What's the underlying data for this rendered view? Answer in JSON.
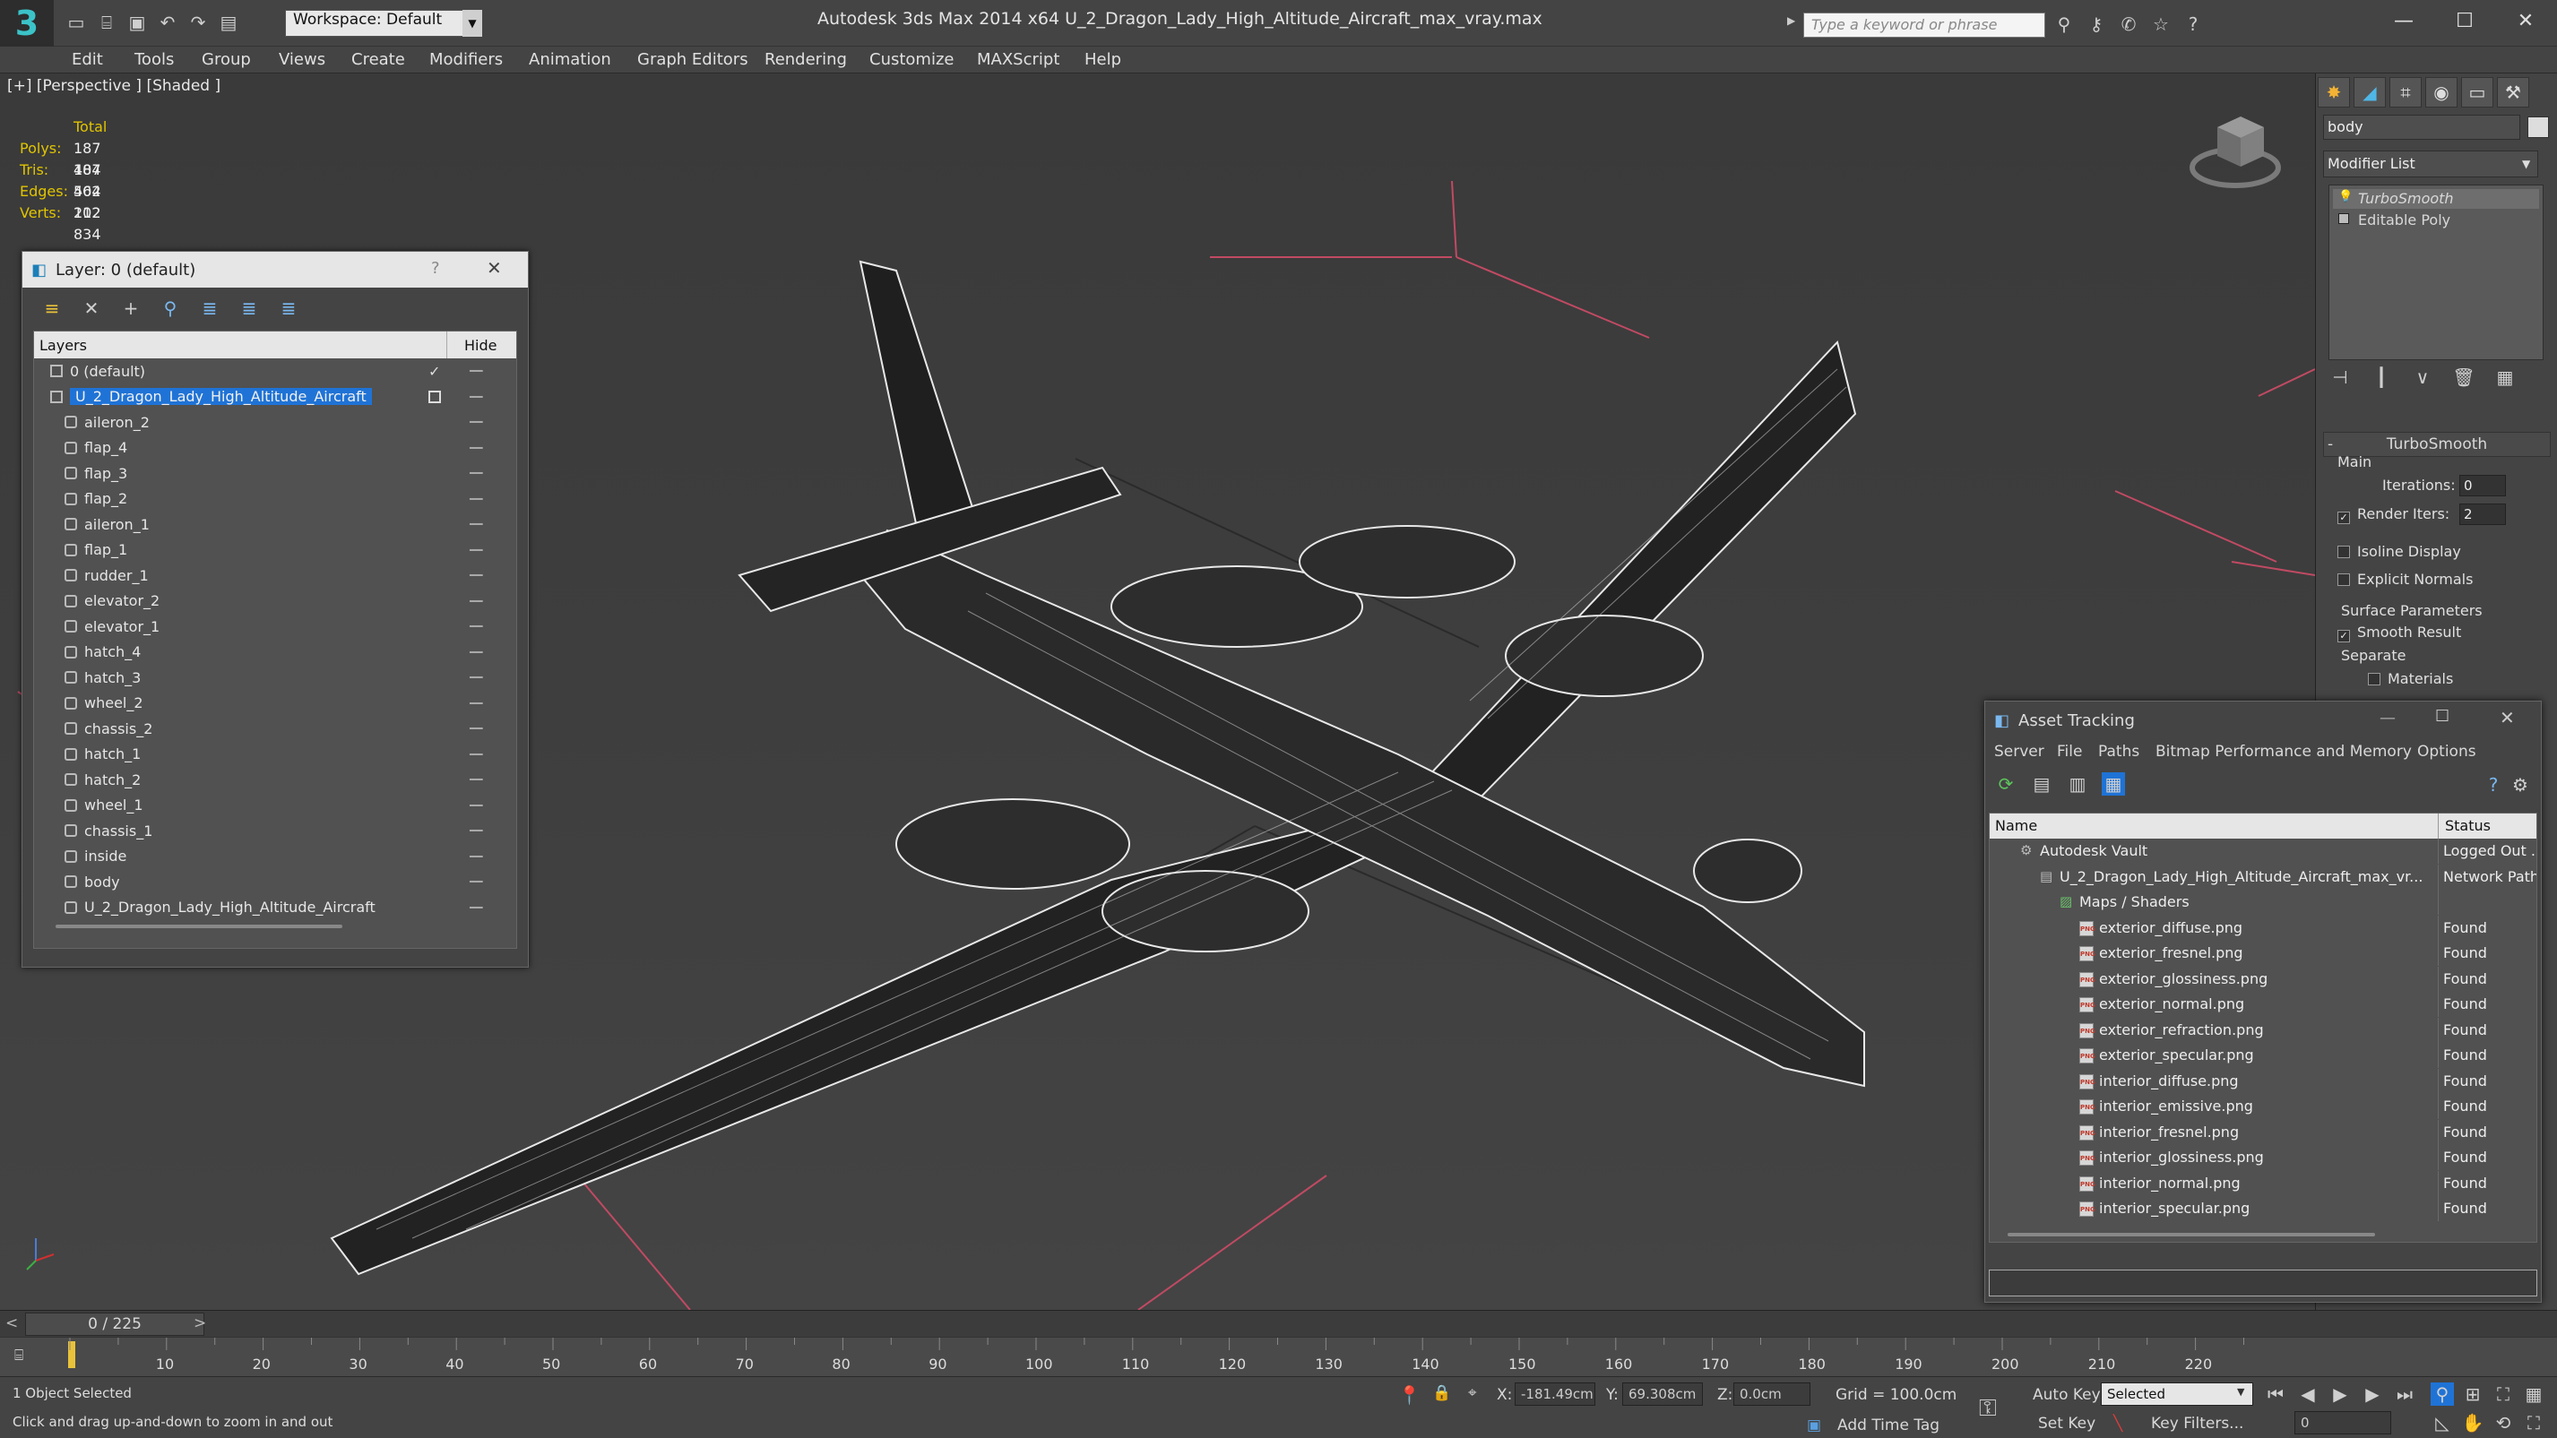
{
  "titlebar": {
    "workspace": "Workspace: Default",
    "app_title": "Autodesk 3ds Max  2014 x64     U_2_Dragon_Lady_High_Altitude_Aircraft_max_vray.max",
    "search_placeholder": "Type a keyword or phrase"
  },
  "menu": [
    "Edit",
    "Tools",
    "Group",
    "Views",
    "Create",
    "Modifiers",
    "Animation",
    "Graph Editors",
    "Rendering",
    "Customize",
    "MAXScript",
    "Help"
  ],
  "viewport": {
    "label": "[+] [Perspective ] [Shaded ]",
    "stats": {
      "header": "Total",
      "rows": [
        {
          "label": "Polys:",
          "value": "187 404"
        },
        {
          "label": "Tris:",
          "value": "187 404"
        },
        {
          "label": "Edges:",
          "value": "562 212"
        },
        {
          "label": "Verts:",
          "value": "102 834"
        }
      ]
    }
  },
  "layer_panel": {
    "title": "Layer: 0 (default)",
    "help": "?",
    "col_layers": "Layers",
    "col_hide": "Hide",
    "rows": [
      {
        "name": "0 (default)",
        "level": 0,
        "type": "layer",
        "selected": false,
        "current": true
      },
      {
        "name": "U_2_Dragon_Lady_High_Altitude_Aircraft",
        "level": 0,
        "type": "layer",
        "selected": true,
        "current": false
      },
      {
        "name": "aileron_2",
        "level": 1,
        "type": "object"
      },
      {
        "name": "flap_4",
        "level": 1,
        "type": "object"
      },
      {
        "name": "flap_3",
        "level": 1,
        "type": "object"
      },
      {
        "name": "flap_2",
        "level": 1,
        "type": "object"
      },
      {
        "name": "aileron_1",
        "level": 1,
        "type": "object"
      },
      {
        "name": "flap_1",
        "level": 1,
        "type": "object"
      },
      {
        "name": "rudder_1",
        "level": 1,
        "type": "object"
      },
      {
        "name": "elevator_2",
        "level": 1,
        "type": "object"
      },
      {
        "name": "elevator_1",
        "level": 1,
        "type": "object"
      },
      {
        "name": "hatch_4",
        "level": 1,
        "type": "object"
      },
      {
        "name": "hatch_3",
        "level": 1,
        "type": "object"
      },
      {
        "name": "wheel_2",
        "level": 1,
        "type": "object"
      },
      {
        "name": "chassis_2",
        "level": 1,
        "type": "object"
      },
      {
        "name": "hatch_1",
        "level": 1,
        "type": "object"
      },
      {
        "name": "hatch_2",
        "level": 1,
        "type": "object"
      },
      {
        "name": "wheel_1",
        "level": 1,
        "type": "object"
      },
      {
        "name": "chassis_1",
        "level": 1,
        "type": "object"
      },
      {
        "name": "inside",
        "level": 1,
        "type": "object"
      },
      {
        "name": "body",
        "level": 1,
        "type": "object"
      },
      {
        "name": "U_2_Dragon_Lady_High_Altitude_Aircraft",
        "level": 1,
        "type": "object"
      }
    ]
  },
  "command_panel": {
    "object_name": "body",
    "modifier_list": "Modifier List",
    "stack": [
      "TurboSmooth",
      "Editable Poly"
    ],
    "rollout_title": "TurboSmooth",
    "group_main": "Main",
    "iterations_label": "Iterations:",
    "iterations_value": "0",
    "render_iters_label": "Render Iters:",
    "render_iters_value": "2",
    "isoline": "Isoline Display",
    "explicit_normals": "Explicit Normals",
    "surface_params": "Surface Parameters",
    "smooth_result": "Smooth Result",
    "separate": "Separate",
    "materials": "Materials"
  },
  "asset_tracking": {
    "title": "Asset Tracking",
    "menu": [
      "Server",
      "File",
      "Paths",
      "Bitmap Performance and Memory",
      "Options"
    ],
    "col_name": "Name",
    "col_status": "Status",
    "rows": [
      {
        "name": "Autodesk Vault",
        "status": "Logged Out ...",
        "level": 0,
        "kind": "vault"
      },
      {
        "name": "U_2_Dragon_Lady_High_Altitude_Aircraft_max_vr...",
        "status": "Network Path",
        "level": 1,
        "kind": "file"
      },
      {
        "name": "Maps / Shaders",
        "status": "",
        "level": 2,
        "kind": "folder"
      },
      {
        "name": "exterior_diffuse.png",
        "status": "Found",
        "level": 3,
        "kind": "png"
      },
      {
        "name": "exterior_fresnel.png",
        "status": "Found",
        "level": 3,
        "kind": "png"
      },
      {
        "name": "exterior_glossiness.png",
        "status": "Found",
        "level": 3,
        "kind": "png"
      },
      {
        "name": "exterior_normal.png",
        "status": "Found",
        "level": 3,
        "kind": "png"
      },
      {
        "name": "exterior_refraction.png",
        "status": "Found",
        "level": 3,
        "kind": "png"
      },
      {
        "name": "exterior_specular.png",
        "status": "Found",
        "level": 3,
        "kind": "png"
      },
      {
        "name": "interior_diffuse.png",
        "status": "Found",
        "level": 3,
        "kind": "png"
      },
      {
        "name": "interior_emissive.png",
        "status": "Found",
        "level": 3,
        "kind": "png"
      },
      {
        "name": "interior_fresnel.png",
        "status": "Found",
        "level": 3,
        "kind": "png"
      },
      {
        "name": "interior_glossiness.png",
        "status": "Found",
        "level": 3,
        "kind": "png"
      },
      {
        "name": "interior_normal.png",
        "status": "Found",
        "level": 3,
        "kind": "png"
      },
      {
        "name": "interior_specular.png",
        "status": "Found",
        "level": 3,
        "kind": "png"
      }
    ]
  },
  "timeline": {
    "frame_display": "0 / 225",
    "ticks": [
      "10",
      "20",
      "30",
      "40",
      "50",
      "60",
      "70",
      "80",
      "90",
      "100",
      "110",
      "120",
      "130",
      "140",
      "150",
      "160",
      "170",
      "180",
      "190",
      "200",
      "210",
      "220"
    ]
  },
  "status": {
    "selection": "1 Object Selected",
    "prompt": "Click and drag up-and-down to zoom in and out",
    "x_label": "X:",
    "x_value": "-181.49cm",
    "y_label": "Y:",
    "y_value": "69.308cm",
    "z_label": "Z:",
    "z_value": "0.0cm",
    "grid": "Grid = 100.0cm",
    "auto_key": "Auto Key",
    "auto_key_mode": "Selected",
    "set_key": "Set Key",
    "key_filters": "Key Filters...",
    "add_time_tag": "Add Time Tag",
    "frame_field": "0"
  },
  "colors": {
    "accent_blue": "#1f73d6",
    "stat_yellow": "#e0c400",
    "grid_pink": "#c04a63",
    "wireframe": "#ffffff"
  }
}
